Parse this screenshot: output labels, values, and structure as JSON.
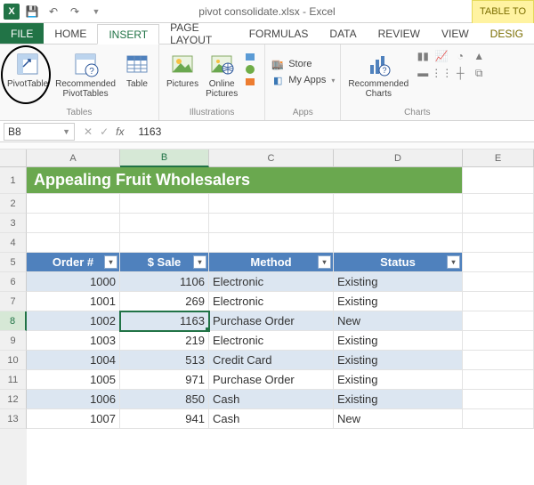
{
  "titlebar": {
    "title": "pivot consolidate.xlsx - Excel",
    "context_tab": "TABLE TO"
  },
  "tabs": {
    "file": "FILE",
    "home": "HOME",
    "insert": "INSERT",
    "page_layout": "PAGE LAYOUT",
    "formulas": "FORMULAS",
    "data": "DATA",
    "review": "REVIEW",
    "view": "VIEW",
    "design": "DESIG"
  },
  "ribbon": {
    "tables": {
      "pivot_table": "PivotTable",
      "recommended": "Recommended\nPivotTables",
      "table": "Table",
      "group": "Tables"
    },
    "illustrations": {
      "pictures": "Pictures",
      "online": "Online\nPictures",
      "group": "Illustrations"
    },
    "apps": {
      "store": "Store",
      "myapps": "My Apps",
      "group": "Apps"
    },
    "charts": {
      "recommended": "Recommended\nCharts",
      "group": "Charts"
    }
  },
  "namebox": "B8",
  "formula": "1163",
  "columns": [
    "A",
    "B",
    "C",
    "D",
    "E"
  ],
  "row_numbers": [
    "1",
    "2",
    "3",
    "4",
    "5",
    "6",
    "7",
    "8",
    "9",
    "10",
    "11",
    "12",
    "13"
  ],
  "sheet": {
    "title": "Appealing Fruit Wholesalers",
    "headers": {
      "order": "Order #",
      "sale": "$ Sale",
      "method": "Method",
      "status": "Status"
    },
    "rows": [
      {
        "order": "1000",
        "sale": "1106",
        "method": "Electronic",
        "status": "Existing"
      },
      {
        "order": "1001",
        "sale": "269",
        "method": "Electronic",
        "status": "Existing"
      },
      {
        "order": "1002",
        "sale": "1163",
        "method": "Purchase Order",
        "status": "New"
      },
      {
        "order": "1003",
        "sale": "219",
        "method": "Electronic",
        "status": "Existing"
      },
      {
        "order": "1004",
        "sale": "513",
        "method": "Credit Card",
        "status": "Existing"
      },
      {
        "order": "1005",
        "sale": "971",
        "method": "Purchase Order",
        "status": "Existing"
      },
      {
        "order": "1006",
        "sale": "850",
        "method": "Cash",
        "status": "Existing"
      },
      {
        "order": "1007",
        "sale": "941",
        "method": "Cash",
        "status": "New"
      }
    ]
  },
  "chart_data": {
    "type": "table",
    "title": "Appealing Fruit Wholesalers",
    "columns": [
      "Order #",
      "$ Sale",
      "Method",
      "Status"
    ],
    "rows": [
      [
        1000,
        1106,
        "Electronic",
        "Existing"
      ],
      [
        1001,
        269,
        "Electronic",
        "Existing"
      ],
      [
        1002,
        1163,
        "Purchase Order",
        "New"
      ],
      [
        1003,
        219,
        "Electronic",
        "Existing"
      ],
      [
        1004,
        513,
        "Credit Card",
        "Existing"
      ],
      [
        1005,
        971,
        "Purchase Order",
        "Existing"
      ],
      [
        1006,
        850,
        "Cash",
        "Existing"
      ],
      [
        1007,
        941,
        "Cash",
        "New"
      ]
    ],
    "selected_cell": "B8"
  }
}
